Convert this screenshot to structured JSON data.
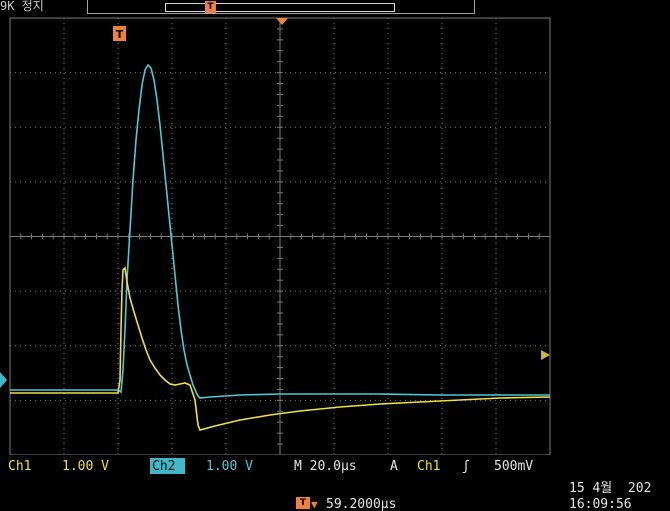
{
  "top_bar": {
    "status_text": "9K 정지",
    "trigger_position_marker": "T"
  },
  "display": {
    "trigger_marker": "T",
    "colors": {
      "background": "#000000",
      "grid": "#7a7a7a",
      "ch1": "#f0e040",
      "ch2": "#50c8d8",
      "marker": "#f08040"
    }
  },
  "readouts": {
    "ch1_label": "Ch1",
    "ch1_scale": "1.00 V",
    "ch2_label": "Ch2",
    "ch2_scale": "1.00 V",
    "timebase": "M 20.0µs",
    "trigger_mode": "A",
    "trigger_source": "Ch1",
    "trigger_slope_icon": "rising-edge-icon",
    "trigger_slope": "ʃ",
    "trigger_level": "500mV",
    "date": "15 4월  202",
    "time": "16:09:56",
    "delay_marker": "T→▼",
    "delay_value": "59.2000µs"
  }
}
